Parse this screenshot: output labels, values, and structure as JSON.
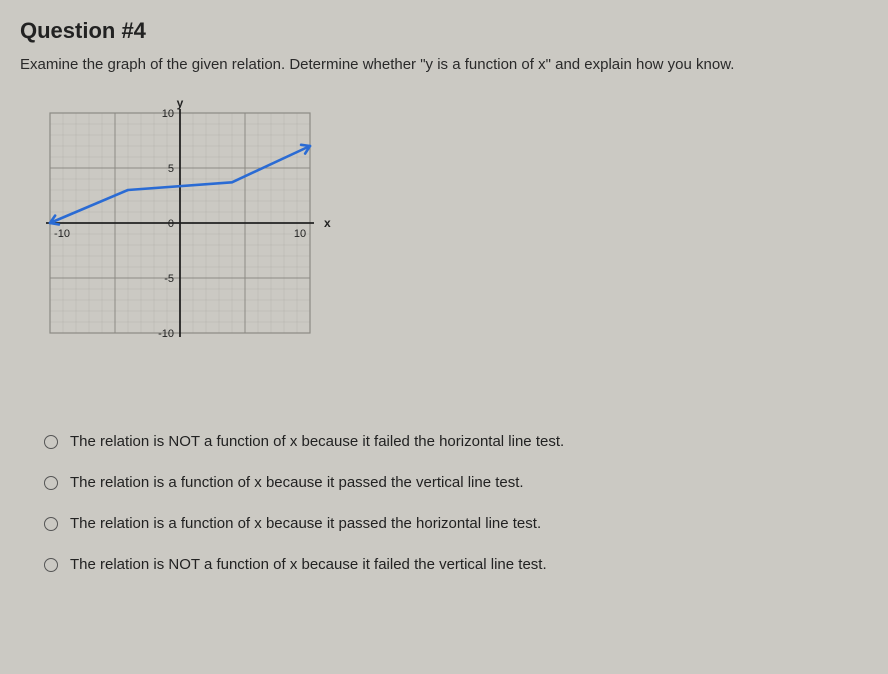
{
  "question": {
    "title": "Question #4",
    "prompt": "Examine the graph of the given relation. Determine whether \"y is a function of x\" and explain how you know."
  },
  "chart_data": {
    "type": "line",
    "xlabel": "x",
    "ylabel": "y",
    "xlim": [
      -10,
      10
    ],
    "ylim": [
      -10,
      10
    ],
    "xticks": [
      -10,
      0,
      10
    ],
    "yticks": [
      -10,
      -5,
      0,
      5,
      10
    ],
    "x": [
      -10,
      -4,
      4,
      10
    ],
    "values": [
      0,
      3,
      3.7,
      7
    ],
    "arrows": "both-ends"
  },
  "options": [
    {
      "label": "The relation is NOT a function of x because it failed the horizontal line test."
    },
    {
      "label": "The relation is a function of x because it passed the vertical line test."
    },
    {
      "label": "The relation is a function of x because it passed the horizontal line test."
    },
    {
      "label": "The relation is NOT a function of x because it failed the vertical line test."
    }
  ]
}
